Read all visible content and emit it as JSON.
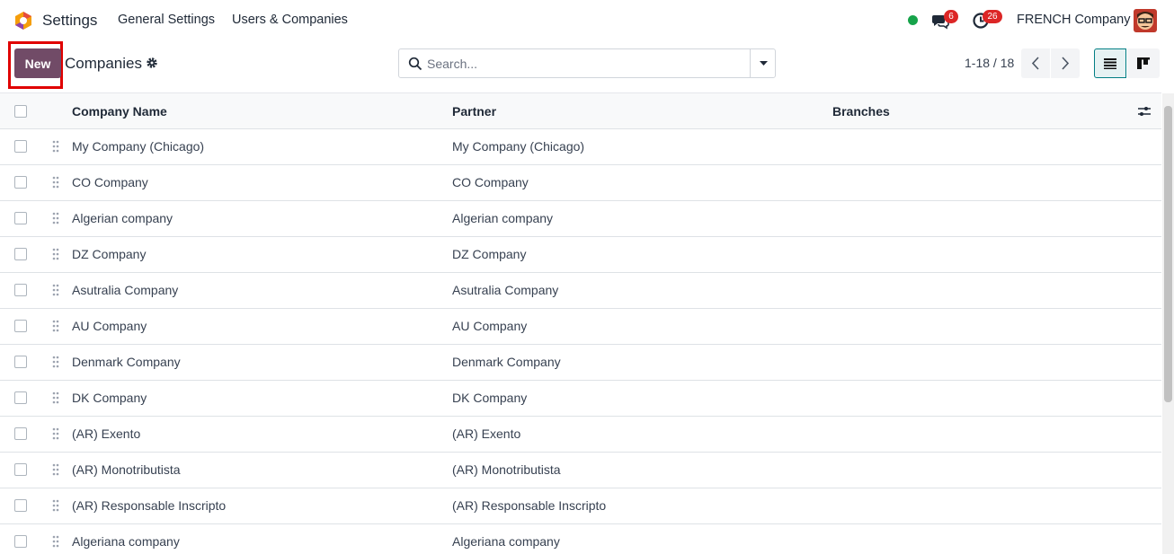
{
  "navbar": {
    "app_name": "Settings",
    "menu": [
      "General Settings",
      "Users & Companies"
    ],
    "messages_count": "6",
    "activities_count": "26",
    "company": "FRENCH Company",
    "status_color": "#16a34a",
    "icons": {
      "messages": "chat-icon",
      "activities": "clock-icon"
    }
  },
  "control_panel": {
    "new_label": "New",
    "title": "Companies",
    "search_placeholder": "Search...",
    "pager": "1-18 / 18",
    "accent_color": "#714B67"
  },
  "table": {
    "columns": [
      "Company Name",
      "Partner",
      "Branches"
    ],
    "rows": [
      {
        "name": "My Company (Chicago)",
        "partner": "My Company (Chicago)",
        "branches": ""
      },
      {
        "name": "CO Company",
        "partner": "CO Company",
        "branches": ""
      },
      {
        "name": "Algerian company",
        "partner": "Algerian company",
        "branches": ""
      },
      {
        "name": "DZ Company",
        "partner": "DZ Company",
        "branches": ""
      },
      {
        "name": "Asutralia Company",
        "partner": "Asutralia Company",
        "branches": ""
      },
      {
        "name": "AU Company",
        "partner": "AU Company",
        "branches": ""
      },
      {
        "name": "Denmark Company",
        "partner": "Denmark Company",
        "branches": ""
      },
      {
        "name": "DK Company",
        "partner": "DK Company",
        "branches": ""
      },
      {
        "name": "(AR) Exento",
        "partner": "(AR) Exento",
        "branches": ""
      },
      {
        "name": "(AR) Monotributista",
        "partner": "(AR) Monotributista",
        "branches": ""
      },
      {
        "name": "(AR) Responsable Inscripto",
        "partner": "(AR) Responsable Inscripto",
        "branches": ""
      },
      {
        "name": "Algeriana company",
        "partner": "Algeriana company",
        "branches": ""
      }
    ]
  }
}
